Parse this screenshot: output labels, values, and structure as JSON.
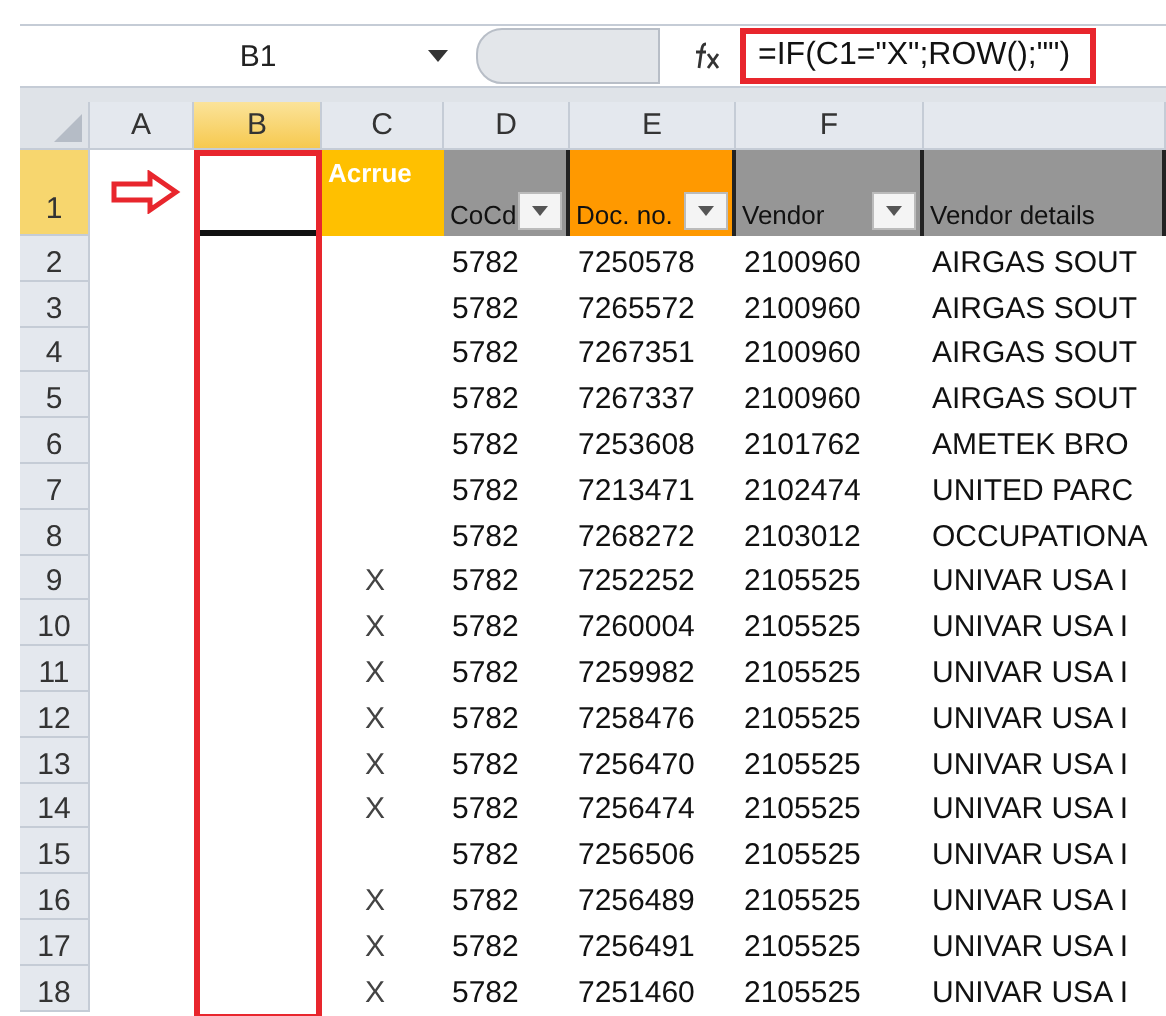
{
  "name_box": "B1",
  "formula": "=IF(C1=\"X\";ROW();\"\")",
  "columns": [
    {
      "label": "A",
      "selected": false
    },
    {
      "label": "B",
      "selected": true
    },
    {
      "label": "C",
      "selected": false
    },
    {
      "label": "D",
      "selected": false
    },
    {
      "label": "E",
      "selected": false
    },
    {
      "label": "F",
      "selected": false
    }
  ],
  "header_row": {
    "number": "1",
    "selected": true,
    "cells": [
      {
        "text": "Acrrue",
        "color": "#ffc000",
        "filter": false
      },
      {
        "text": "CoCd",
        "color": "#969696",
        "filter": true
      },
      {
        "text": "Doc. no.",
        "color": "#ff9900",
        "filter": true
      },
      {
        "text": "Vendor",
        "color": "#969696",
        "filter": true
      },
      {
        "text": "Vendor details",
        "color": "#969696",
        "filter": false
      }
    ]
  },
  "rows": [
    {
      "number": "2",
      "cocd": "5782",
      "doc_no": "7250578",
      "vendor": "2100960",
      "details": "AIRGAS SOUT"
    },
    {
      "number": "3",
      "cocd": "5782",
      "doc_no": "7265572",
      "vendor": "2100960",
      "details": "AIRGAS SOUT"
    },
    {
      "number": "4",
      "cocd": "5782",
      "doc_no": "7267351",
      "vendor": "2100960",
      "details": "AIRGAS SOUT"
    },
    {
      "number": "5",
      "cocd": "5782",
      "doc_no": "7267337",
      "vendor": "2100960",
      "details": "AIRGAS SOUT"
    },
    {
      "number": "6",
      "cocd": "5782",
      "doc_no": "7253608",
      "vendor": "2101762",
      "details": "AMETEK BRO"
    },
    {
      "number": "7",
      "cocd": "5782",
      "doc_no": "7213471",
      "vendor": "2102474",
      "details": "UNITED PARC"
    },
    {
      "number": "8",
      "cocd": "5782",
      "doc_no": "7268272",
      "vendor": "2103012",
      "details": "OCCUPATIONA"
    },
    {
      "number": "9",
      "accrue": "X",
      "cocd": "5782",
      "doc_no": "7252252",
      "vendor": "2105525",
      "details": "UNIVAR USA I"
    },
    {
      "number": "10",
      "accrue": "X",
      "cocd": "5782",
      "doc_no": "7260004",
      "vendor": "2105525",
      "details": "UNIVAR USA I"
    },
    {
      "number": "11",
      "accrue": "X",
      "cocd": "5782",
      "doc_no": "7259982",
      "vendor": "2105525",
      "details": "UNIVAR USA I"
    },
    {
      "number": "12",
      "accrue": "X",
      "cocd": "5782",
      "doc_no": "7258476",
      "vendor": "2105525",
      "details": "UNIVAR USA I"
    },
    {
      "number": "13",
      "accrue": "X",
      "cocd": "5782",
      "doc_no": "7256470",
      "vendor": "2105525",
      "details": "UNIVAR USA I"
    },
    {
      "number": "14",
      "accrue": "X",
      "cocd": "5782",
      "doc_no": "7256474",
      "vendor": "2105525",
      "details": "UNIVAR USA I"
    },
    {
      "number": "15",
      "cocd": "5782",
      "doc_no": "7256506",
      "vendor": "2105525",
      "details": "UNIVAR USA I"
    },
    {
      "number": "16",
      "accrue": "X",
      "cocd": "5782",
      "doc_no": "7256489",
      "vendor": "2105525",
      "details": "UNIVAR USA I"
    },
    {
      "number": "17",
      "accrue": "X",
      "cocd": "5782",
      "doc_no": "7256491",
      "vendor": "2105525",
      "details": "UNIVAR USA I"
    },
    {
      "number": "18",
      "accrue": "X",
      "cocd": "5782",
      "doc_no": "7251460",
      "vendor": "2105525",
      "details": "UNIVAR USA I"
    }
  ]
}
